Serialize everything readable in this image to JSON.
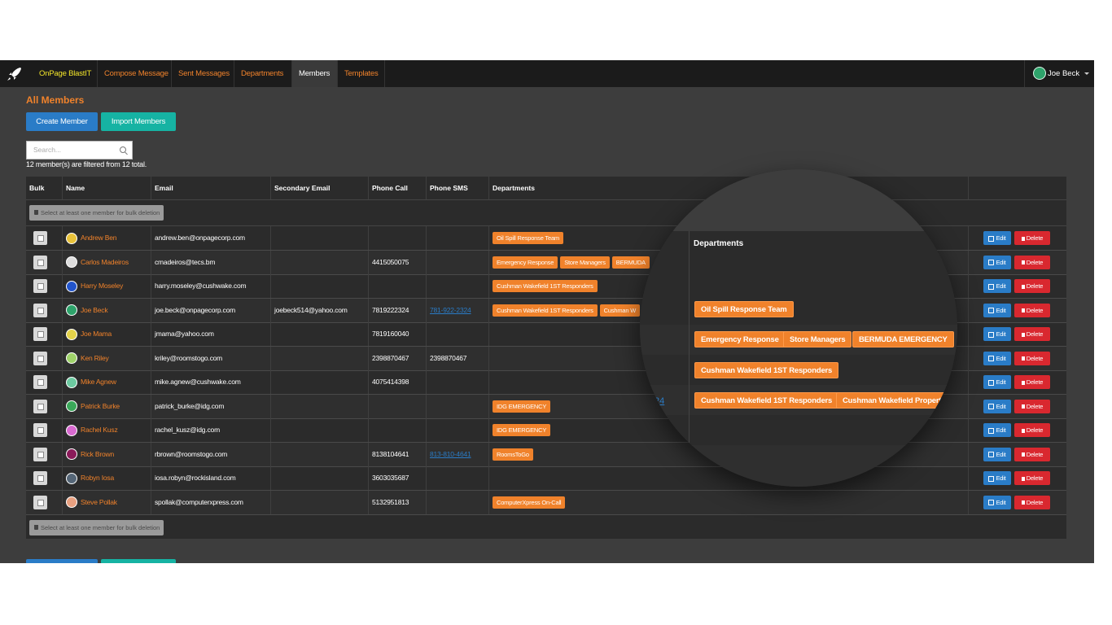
{
  "nav": {
    "brand": "OnPage BlastIT",
    "items": [
      "Compose Message",
      "Sent Messages",
      "Departments",
      "Members",
      "Templates"
    ],
    "active": "Members",
    "user": "Joe Beck"
  },
  "page": {
    "title": "All Members",
    "create_label": "Create Member",
    "import_label": "Import Members",
    "search_placeholder": "Search...",
    "filter_info": "12 member(s) are filtered from 12 total.",
    "bulk_label": "Select at least one member for bulk deletion"
  },
  "table": {
    "columns": [
      "Bulk",
      "Name",
      "Email",
      "Secondary Email",
      "Phone Call",
      "Phone SMS",
      "Departments"
    ],
    "edit_label": "Edit",
    "delete_label": "Delete",
    "rows": [
      {
        "name": "Andrew Ben",
        "email": "andrew.ben@onpagecorp.com",
        "secondary": "",
        "phone": "",
        "sms": "",
        "departments": [
          "Oil Spill Response Team"
        ],
        "avatar_color": "#e8c23a"
      },
      {
        "name": "Carlos Madeiros",
        "email": "cmadeiros@tecs.bm",
        "secondary": "",
        "phone": "4415050075",
        "sms": "",
        "departments": [
          "Emergency Response",
          "Store Managers",
          "BERMUDA"
        ],
        "avatar_color": "#dddddd"
      },
      {
        "name": "Harry Moseley",
        "email": "harry.moseley@cushwake.com",
        "secondary": "",
        "phone": "",
        "sms": "",
        "departments": [
          "Cushman Wakefield 1ST Responders"
        ],
        "avatar_color": "#2255cc"
      },
      {
        "name": "Joe Beck",
        "email": "joe.beck@onpagecorp.com",
        "secondary": "joebeck514@yahoo.com",
        "phone": "7819222324",
        "sms": "781-922-2324",
        "departments": [
          "Cushman Wakefield 1ST Responders",
          "Cushman W"
        ],
        "avatar_color": "#2ea36b"
      },
      {
        "name": "Joe Mama",
        "email": "jmama@yahoo.com",
        "secondary": "",
        "phone": "7819160040",
        "sms": "",
        "departments": [],
        "avatar_color": "#e3d24a"
      },
      {
        "name": "Ken Riley",
        "email": "kriley@roomstogo.com",
        "secondary": "",
        "phone": "2398870467",
        "sms": "2398870467",
        "departments": [],
        "avatar_color": "#9fd36a"
      },
      {
        "name": "Mike Agnew",
        "email": "mike.agnew@cushwake.com",
        "secondary": "",
        "phone": "4075414398",
        "sms": "",
        "departments": [],
        "avatar_color": "#6cc9a0"
      },
      {
        "name": "Patrick Burke",
        "email": "patrick_burke@idg.com",
        "secondary": "",
        "phone": "",
        "sms": "",
        "departments": [
          "IDG EMERGENCY"
        ],
        "avatar_color": "#3aa85a"
      },
      {
        "name": "Rachel Kusz",
        "email": "rachel_kusz@idg.com",
        "secondary": "",
        "phone": "",
        "sms": "",
        "departments": [
          "IDG EMERGENCY"
        ],
        "avatar_color": "#d86ad0"
      },
      {
        "name": "Rick Brown",
        "email": "rbrown@roomstogo.com",
        "secondary": "",
        "phone": "8138104641",
        "sms": "813-810-4641",
        "departments": [
          "RoomsToGo"
        ],
        "avatar_color": "#8a1a5a"
      },
      {
        "name": "Robyn Iosa",
        "email": "iosa.robyn@rockisland.com",
        "secondary": "",
        "phone": "3603035687",
        "sms": "",
        "departments": [],
        "avatar_color": "#556677"
      },
      {
        "name": "Steve Pollak",
        "email": "spollak@computerxpress.com",
        "secondary": "",
        "phone": "5132951813",
        "sms": "",
        "departments": [
          "ComputerXpress On-Call"
        ],
        "avatar_color": "#e8a080"
      }
    ]
  },
  "magnifier": {
    "header": "Departments",
    "link_fragment": "24",
    "rows": [
      [
        "Oil Spill Response Team"
      ],
      [
        "Emergency Response",
        "Store Managers",
        "BERMUDA EMERGENCY"
      ],
      [
        "Cushman Wakefield 1ST Responders"
      ],
      [
        "Cushman Wakefield 1ST Responders",
        "Cushman Wakefield Propert"
      ]
    ]
  }
}
